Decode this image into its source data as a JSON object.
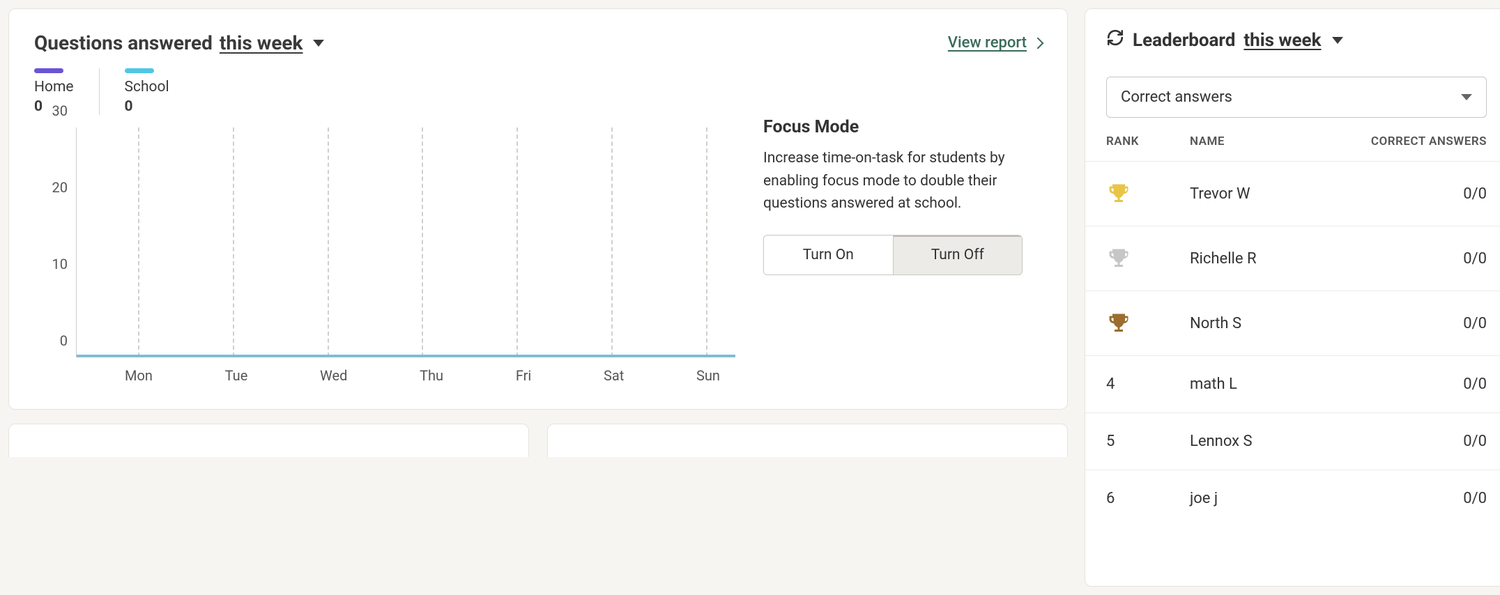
{
  "questions": {
    "title_prefix": "Questions answered",
    "title_period": "this week",
    "view_report": "View report",
    "legend": {
      "home": {
        "label": "Home",
        "value": "0"
      },
      "school": {
        "label": "School",
        "value": "0"
      }
    },
    "focus": {
      "title": "Focus Mode",
      "description": "Increase time-on-task for students by enabling focus mode to double their questions answered at school.",
      "on_label": "Turn On",
      "off_label": "Turn Off"
    }
  },
  "leaderboard": {
    "title_prefix": "Leaderboard",
    "title_period": "this week",
    "selector": "Correct answers",
    "columns": {
      "rank": "RANK",
      "name": "NAME",
      "score": "CORRECT ANSWERS"
    },
    "rows": [
      {
        "rank": "trophy-gold",
        "name": "Trevor W",
        "score": "0/0"
      },
      {
        "rank": "trophy-silver",
        "name": "Richelle R",
        "score": "0/0"
      },
      {
        "rank": "trophy-bronze",
        "name": "North S",
        "score": "0/0"
      },
      {
        "rank": "4",
        "name": "math L",
        "score": "0/0"
      },
      {
        "rank": "5",
        "name": "Lennox S",
        "score": "0/0"
      },
      {
        "rank": "6",
        "name": "joe j",
        "score": "0/0"
      }
    ]
  },
  "chart_data": {
    "type": "line",
    "categories": [
      "Mon",
      "Tue",
      "Wed",
      "Thu",
      "Fri",
      "Sat",
      "Sun"
    ],
    "series": [
      {
        "name": "Home",
        "values": [
          0,
          0,
          0,
          0,
          0,
          0,
          0
        ],
        "color": "#6b53d6"
      },
      {
        "name": "School",
        "values": [
          0,
          0,
          0,
          0,
          0,
          0,
          0
        ],
        "color": "#4fc7e6"
      }
    ],
    "ylim": [
      0,
      30
    ],
    "y_ticks": [
      0,
      10,
      20,
      30
    ],
    "title": "Questions answered this week",
    "xlabel": "",
    "ylabel": ""
  }
}
